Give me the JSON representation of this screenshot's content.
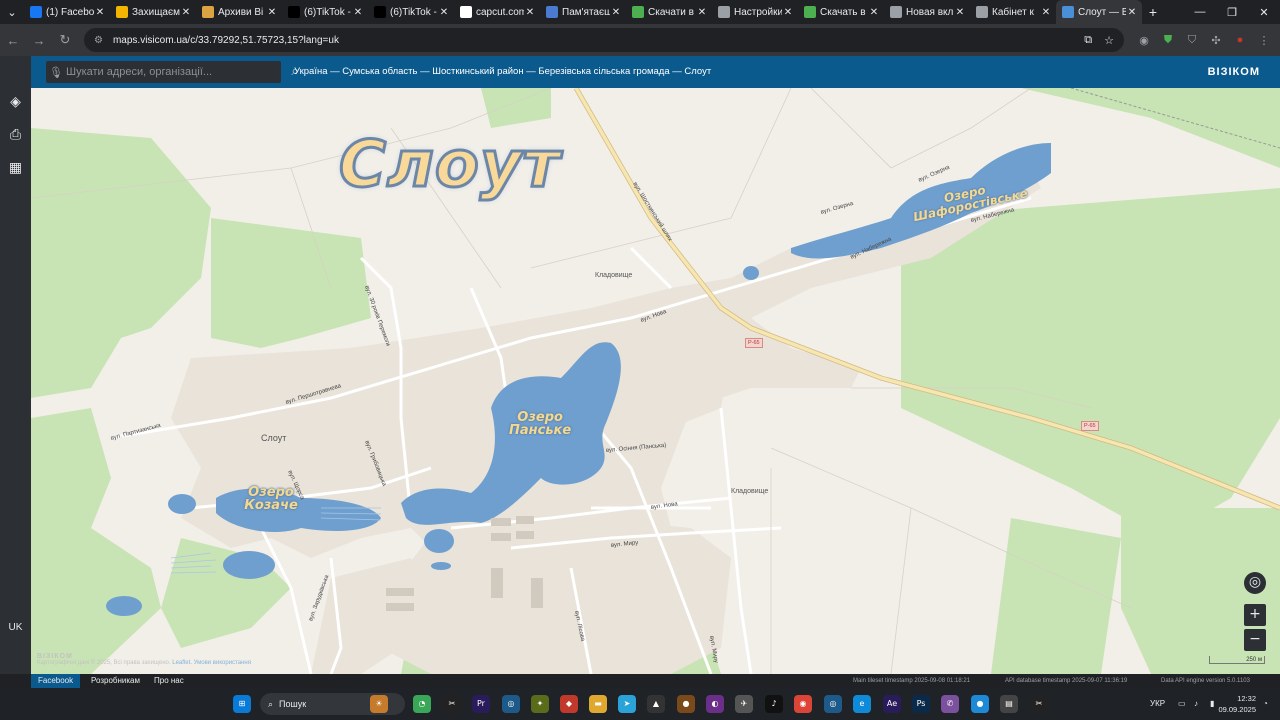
{
  "browser": {
    "tabs": [
      {
        "label": "(1) Facebook",
        "icon": "facebook-icon",
        "color": "#1877f2"
      },
      {
        "label": "Захищаємо",
        "icon": "smile-icon",
        "color": "#f4b400"
      },
      {
        "label": "Архиви Ві",
        "icon": "butterfly-icon",
        "color": "#d9a441"
      },
      {
        "label": "(6)TikTok -",
        "icon": "tiktok-icon",
        "color": "#000000"
      },
      {
        "label": "(6)TikTok -",
        "icon": "tiktok-icon",
        "color": "#000000"
      },
      {
        "label": "capcut.com",
        "icon": "capcut-icon",
        "color": "#ffffff"
      },
      {
        "label": "Пам'ятаєш",
        "icon": "doc-icon",
        "color": "#4a7bd0"
      },
      {
        "label": "Скачати в",
        "icon": "download-icon",
        "color": "#4caf50"
      },
      {
        "label": "Настройки",
        "icon": "gear-icon",
        "color": "#9aa0a6"
      },
      {
        "label": "Скачать в",
        "icon": "download-icon",
        "color": "#4caf50"
      },
      {
        "label": "Новая вкл",
        "icon": "globe-icon",
        "color": "#9aa0a6"
      },
      {
        "label": "Кабінет к",
        "icon": "globe-icon",
        "color": "#9aa0a6"
      },
      {
        "label": "Слоут — В",
        "icon": "map-icon",
        "color": "#4a90d9",
        "active": true
      }
    ],
    "new_tab": "+",
    "url": "maps.visicom.ua/c/33.79292,51.75723,15?lang=uk"
  },
  "sidebar": {
    "language": "UK"
  },
  "header": {
    "search_placeholder": "Шукати адреси, організації...",
    "breadcrumb": "Україна — Сумська область — Шосткинський район — Березівська сільська громада — Слоут",
    "brand": "ВІЗІКОМ"
  },
  "map": {
    "city_title": "Слоут",
    "lakes": [
      {
        "name": "Озеро Панське"
      },
      {
        "name": "Озеро Козаче"
      },
      {
        "name": "Озеро Шафоростівське"
      }
    ],
    "labels": {
      "village": "Слоут",
      "cemetery_1": "Кладовище",
      "cemetery_2": "Кладовище"
    },
    "roads": {
      "shostkynskyi": "вул. Шосткинський шлях",
      "pershotravneva": "вул. Першотравнева",
      "partyzanska": "вул. Партизанська",
      "ozerna_1": "вул. Озерна",
      "ozerna_2": "вул. Озерна",
      "naberezhna_1": "вул. Набережна",
      "naberezhna_2": "вул. Набережна",
      "nova_1": "вул. Нова",
      "nova_2": "вул. Нова",
      "myru_1": "вул. Миру",
      "myru_2": "вул. Миру",
      "osinnya": "вул. Осіння (Панська)",
      "hrybovytska": "вул. Грибовицька",
      "shchorsa": "вул. Щорса",
      "lisova": "вул. Лісова",
      "zarudkivska": "вул. Зарудківська",
      "pl_peremohy": "вул. 30 років Перемоги"
    },
    "route_badges": [
      "Р-65",
      "Р-65"
    ],
    "scale": "250 м",
    "attribution_text": "Картографічні дані © 2025, Всі права захищено. ",
    "attribution_link": "Leaflet. Умови використання",
    "logo": "ВІЗІКОМ",
    "controls": {
      "locate": "◎",
      "zoom_in": "+",
      "zoom_out": "−"
    }
  },
  "footer": {
    "links": [
      "Facebook",
      "Розробникам",
      "Про нас"
    ],
    "tileset": "Main tileset timestamp 2025-09-08 01:18:21",
    "api": "API database timestamp 2025-09-07 11:36:19",
    "engine": "Data API engine version 5.0.1103"
  },
  "taskbar": {
    "search": "Пошук",
    "lang": "УКР",
    "time": "12:32",
    "date": "09.09.2025"
  },
  "colors": {
    "header": "#0b5a8e",
    "water": "#6f9fce",
    "forest": "#c8e3b4",
    "road": "#e3ddd3",
    "highway": "#f6e6b0"
  }
}
